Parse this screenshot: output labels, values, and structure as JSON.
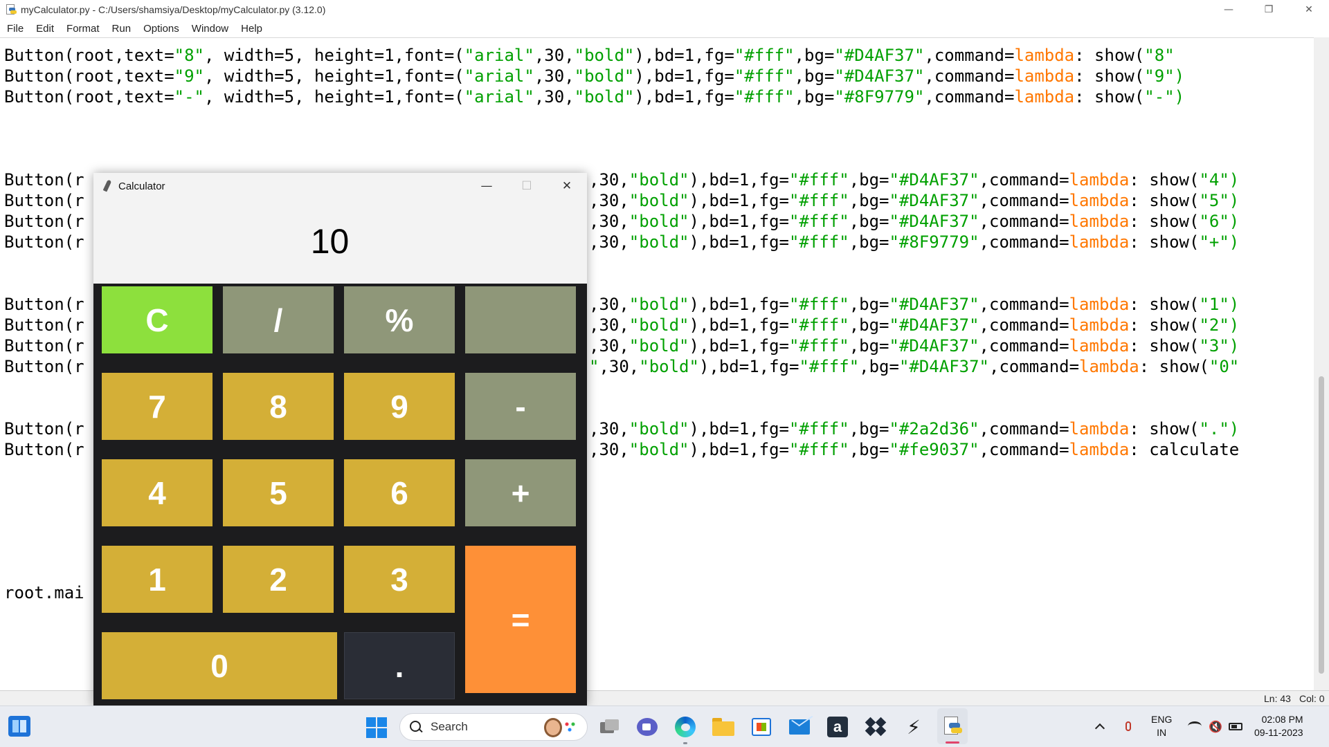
{
  "idle": {
    "window_title": "myCalculator.py - C:/Users/shamsiya/Desktop/myCalculator.py (3.12.0)",
    "controls": {
      "minimize": "—",
      "restore": "❐",
      "close": "✕"
    },
    "menu": [
      "File",
      "Edit",
      "Format",
      "Run",
      "Options",
      "Window",
      "Help"
    ],
    "code": {
      "row1": {
        "a": "Button(root,text=",
        "s1": "\"8\"",
        "b": ", width=5, height=1,font=(",
        "s2": "\"arial\"",
        "c": ",30,",
        "s3": "\"bold\"",
        "d": "),bd=1,fg=",
        "s4": "\"#fff\"",
        "e": ",bg=",
        "s5": "\"#D4AF37\"",
        "f": ",command=",
        "k": "lambda",
        "g": ": show(",
        "s6": "\"8\""
      },
      "row2": {
        "a": "Button(root,text=",
        "s1": "\"9\"",
        "b": ", width=5, height=1,font=(",
        "s2": "\"arial\"",
        "c": ",30,",
        "s3": "\"bold\"",
        "d": "),bd=1,fg=",
        "s4": "\"#fff\"",
        "e": ",bg=",
        "s5": "\"#D4AF37\"",
        "f": ",command=",
        "k": "lambda",
        "g": ": show(",
        "s6": "\"9\")"
      },
      "row3": {
        "a": "Button(root,text=",
        "s1": "\"-\"",
        "b": ", width=5, height=1,font=(",
        "s2": "\"arial\"",
        "c": ",30,",
        "s3": "\"bold\"",
        "d": "),bd=1,fg=",
        "s4": "\"#fff\"",
        "e": ",bg=",
        "s5": "\"#8F9779\"",
        "f": ",command=",
        "k": "lambda",
        "g": ": show(",
        "s6": "\"-\")"
      },
      "row4": {
        "a": "Button(r",
        "c": ",30,",
        "s3": "\"bold\"",
        "d": "),bd=1,fg=",
        "s4": "\"#fff\"",
        "e": ",bg=",
        "s5": "\"#D4AF37\"",
        "f": ",command=",
        "k": "lambda",
        "g": ": show(",
        "s6": "\"4\")"
      },
      "row5": {
        "a": "Button(r",
        "c": ",30,",
        "s3": "\"bold\"",
        "d": "),bd=1,fg=",
        "s4": "\"#fff\"",
        "e": ",bg=",
        "s5": "\"#D4AF37\"",
        "f": ",command=",
        "k": "lambda",
        "g": ": show(",
        "s6": "\"5\")"
      },
      "row6": {
        "a": "Button(r",
        "c": ",30,",
        "s3": "\"bold\"",
        "d": "),bd=1,fg=",
        "s4": "\"#fff\"",
        "e": ",bg=",
        "s5": "\"#D4AF37\"",
        "f": ",command=",
        "k": "lambda",
        "g": ": show(",
        "s6": "\"6\")"
      },
      "row7": {
        "a": "Button(r",
        "c": ",30,",
        "s3": "\"bold\"",
        "d": "),bd=1,fg=",
        "s4": "\"#fff\"",
        "e": ",bg=",
        "s5": "\"#8F9779\"",
        "f": ",command=",
        "k": "lambda",
        "g": ": show(",
        "s6": "\"+\")"
      },
      "row8": {
        "a": "Button(r",
        "c": ",30,",
        "s3": "\"bold\"",
        "d": "),bd=1,fg=",
        "s4": "\"#fff\"",
        "e": ",bg=",
        "s5": "\"#D4AF37\"",
        "f": ",command=",
        "k": "lambda",
        "g": ": show(",
        "s6": "\"1\")"
      },
      "row9": {
        "a": "Button(r",
        "c": ",30,",
        "s3": "\"bold\"",
        "d": "),bd=1,fg=",
        "s4": "\"#fff\"",
        "e": ",bg=",
        "s5": "\"#D4AF37\"",
        "f": ",command=",
        "k": "lambda",
        "g": ": show(",
        "s6": "\"2\")"
      },
      "row10": {
        "a": "Button(r",
        "c": ",30,",
        "s3": "\"bold\"",
        "d": "),bd=1,fg=",
        "s4": "\"#fff\"",
        "e": ",bg=",
        "s5": "\"#D4AF37\"",
        "f": ",command=",
        "k": "lambda",
        "g": ": show(",
        "s6": "\"3\")"
      },
      "row11": {
        "a": "Button(r",
        "s0": "\"",
        "c": ",30,",
        "s3": "\"bold\"",
        "d": "),bd=1,fg=",
        "s4": "\"#fff\"",
        "e": ",bg=",
        "s5": "\"#D4AF37\"",
        "f": ",command=",
        "k": "lambda",
        "g": ": show(",
        "s6": "\"0\""
      },
      "row12": {
        "a": "Button(r",
        "c": ",30,",
        "s3": "\"bold\"",
        "d": "),bd=1,fg=",
        "s4": "\"#fff\"",
        "e": ",bg=",
        "s5": "\"#2a2d36\"",
        "f": ",command=",
        "k": "lambda",
        "g": ": show(",
        "s6": "\".\")"
      },
      "row13": {
        "a": "Button(r",
        "c": ",30,",
        "s3": "\"bold\"",
        "d": "),bd=1,fg=",
        "s4": "\"#fff\"",
        "e": ",bg=",
        "s5": "\"#fe9037\"",
        "f": ",command=",
        "k": "lambda",
        "g": ": calculate"
      },
      "row14": {
        "a": "root.mai"
      }
    },
    "status": {
      "line": "Ln: 43",
      "col": "Col: 0"
    }
  },
  "calculator": {
    "title": "Calculator",
    "controls": {
      "minimize": "—",
      "maximize": "☐",
      "close": "✕"
    },
    "display": "10",
    "buttons": {
      "clear": "C",
      "divide": "/",
      "percent": "%",
      "blank": "",
      "seven": "7",
      "eight": "8",
      "nine": "9",
      "minus": "-",
      "four": "4",
      "five": "5",
      "six": "6",
      "plus": "+",
      "one": "1",
      "two": "2",
      "three": "3",
      "equals": "=",
      "zero": "0",
      "dot": "."
    },
    "colors": {
      "gold": "#D4AF37",
      "grey": "#8F9779",
      "green": "#8de03d",
      "dark": "#2a2d36",
      "orange": "#fe9037",
      "panel": "#1c1c1e"
    }
  },
  "taskbar": {
    "search": "Search",
    "amazon": "a",
    "bolt": "⚡",
    "tray": {
      "lang1": "ENG",
      "lang2": "IN",
      "time": "02:08 PM",
      "date": "09-11-2023",
      "speaker": "🔇"
    },
    "icons": [
      "widgets-icon",
      "windows-start-icon",
      "search-icon",
      "task-view-icon",
      "teams-meet-icon",
      "edge-icon",
      "file-explorer-icon",
      "microsoft-store-icon",
      "mail-icon",
      "amazon-icon",
      "dropbox-icon",
      "bolt-app-icon",
      "python-idle-icon",
      "chevron-up-icon",
      "microphone-icon",
      "wifi-icon",
      "speaker-muted-icon",
      "battery-icon"
    ]
  }
}
